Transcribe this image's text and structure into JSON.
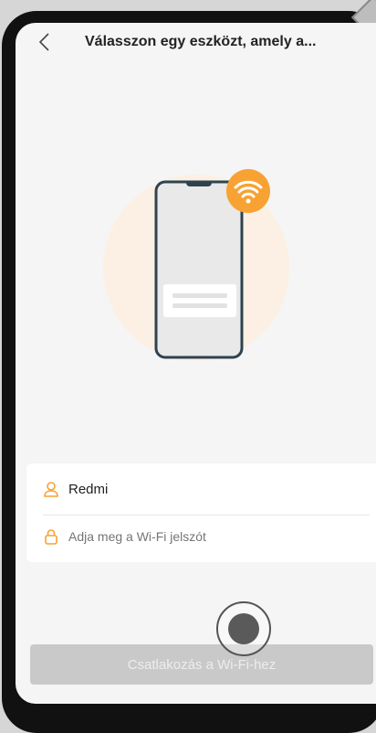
{
  "header": {
    "title": "Válasszon egy eszközt, amely a..."
  },
  "form": {
    "ssid_value": "Redmi",
    "password_placeholder": "Adja meg a Wi-Fi jelszót"
  },
  "actions": {
    "connect_label": "Csatlakozás a Wi-Fi-hez"
  },
  "icons": {
    "back": "chevron-left-icon",
    "wifi_badge": "wifi-icon",
    "user": "user-icon",
    "lock": "lock-icon"
  },
  "colors": {
    "accent": "#f7a233",
    "screen_bg": "#f5f5f5",
    "button_disabled": "#c9c9c9",
    "phone_outline": "#2e4250"
  }
}
